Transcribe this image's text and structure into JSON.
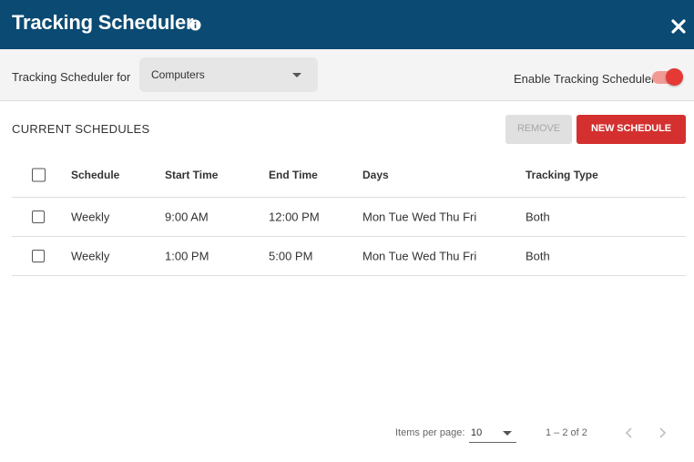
{
  "dialog": {
    "title": "Tracking Scheduler",
    "info_icon": "info-icon",
    "close_icon": "close-icon"
  },
  "toolbar": {
    "scheduler_for_label": "Tracking Scheduler for",
    "target_select": {
      "value": "Computers"
    },
    "enable_label": "Enable Tracking Scheduler",
    "enabled": true
  },
  "schedules": {
    "section_title": "CURRENT SCHEDULES",
    "remove_label": "REMOVE",
    "new_label": "NEW SCHEDULE",
    "columns": [
      "Schedule",
      "Start Time",
      "End Time",
      "Days",
      "Tracking Type"
    ],
    "rows": [
      {
        "schedule": "Weekly",
        "start": "9:00 AM",
        "end": "12:00 PM",
        "days": "Mon Tue Wed Thu Fri",
        "type": "Both",
        "checked": false
      },
      {
        "schedule": "Weekly",
        "start": "1:00 PM",
        "end": "5:00 PM",
        "days": "Mon Tue Wed Thu Fri",
        "type": "Both",
        "checked": false
      }
    ]
  },
  "paginator": {
    "items_per_page_label": "Items per page:",
    "items_per_page": "10",
    "range_label": "1 – 2 of 2"
  },
  "colors": {
    "header_bg": "#0a4a73",
    "accent_red": "#d3302f",
    "toggle_on": "#e53935"
  }
}
